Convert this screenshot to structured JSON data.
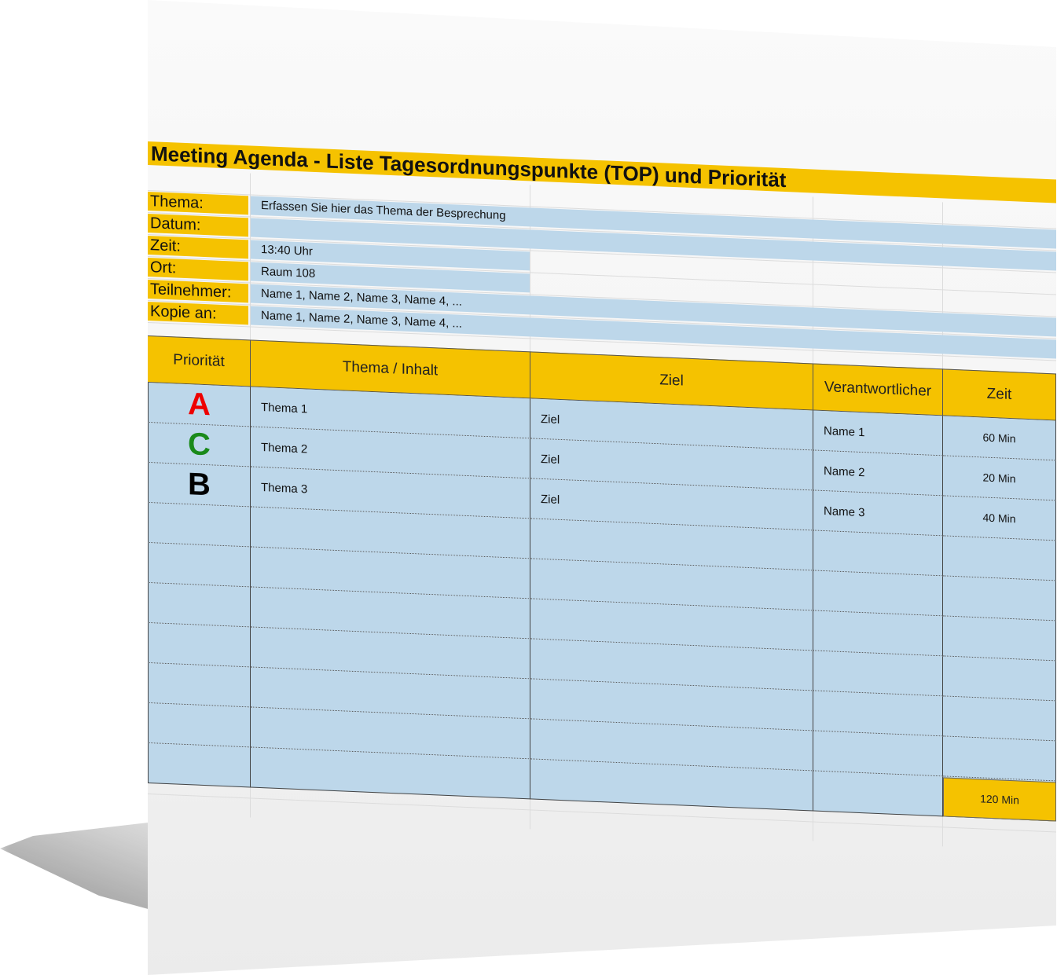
{
  "title": "Meeting Agenda - Liste Tagesordnungspunkte (TOP) und Priorität",
  "fields": [
    {
      "label": "Thema:",
      "value": "Erfassen Sie hier das Thema der Besprechung"
    },
    {
      "label": "Datum:",
      "value": ""
    },
    {
      "label": "Zeit:",
      "value": "13:40 Uhr"
    },
    {
      "label": "Ort:",
      "value": "Raum 108"
    },
    {
      "label": "Teilnehmer:",
      "value": "Name 1, Name 2, Name 3, Name 4, ..."
    },
    {
      "label": "Kopie an:",
      "value": "Name 1, Name 2, Name 3, Name 4, ..."
    }
  ],
  "table": {
    "headers": [
      "Priorität",
      "Thema / Inhalt",
      "Ziel",
      "Verantwortlicher",
      "Zeit"
    ],
    "rows": [
      {
        "prio": "A",
        "prio_color": "#ee0000",
        "thema": "Thema 1",
        "ziel": "Ziel",
        "verantwortlich": "Name 1",
        "zeit": "60 Min"
      },
      {
        "prio": "C",
        "prio_color": "#1a8a1a",
        "thema": "Thema 2",
        "ziel": "Ziel",
        "verantwortlich": "Name 2",
        "zeit": "20 Min"
      },
      {
        "prio": "B",
        "prio_color": "#000000",
        "thema": "Thema 3",
        "ziel": "Ziel",
        "verantwortlich": "Name 3",
        "zeit": "40 Min"
      }
    ],
    "empty_rows": 7,
    "total": "120 Min"
  },
  "colors": {
    "header": "#f5c200",
    "cell": "#bdd7ea"
  }
}
